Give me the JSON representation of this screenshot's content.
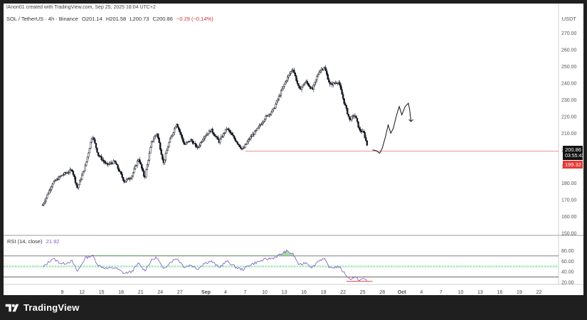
{
  "credit": "lAnon01 created with TradingView.com, Sep 25, 2025 18:04 UTC+2",
  "symbol": {
    "pair": "SOL / TetherUS · 4h · Binance",
    "open": "O201.14",
    "high": "H201.58",
    "low": "L200.73",
    "close": "C200.86",
    "change": "−0.29 (−0.14%)"
  },
  "currency": "USDT",
  "price_tag": "200.86",
  "countdown": "03:55:43",
  "level_tag": "199.32",
  "rsi_legend": {
    "label": "RSI (14, close)",
    "value": "21.92"
  },
  "brand": "TradingView",
  "colors": {
    "candle": "#131722",
    "level_line": "#e57373",
    "rsi_line": "#7e57c2",
    "overbought_fill": "#66bb6a",
    "mid_band": "#b9f6ca",
    "oversold_line": "#ef5350"
  },
  "chart_data": [
    {
      "type": "candlestick",
      "title": "",
      "ylim": [
        150,
        275
      ],
      "y_ticks": [
        150,
        160,
        170,
        180,
        190,
        200,
        210,
        220,
        230,
        240,
        250,
        260,
        270
      ],
      "y_tick_labels": [
        "150.00",
        "160.00",
        "170.00",
        "180.00",
        "190.00",
        "200.00",
        "210.00",
        "220.00",
        "230.00",
        "240.00",
        "250.00",
        "260.00",
        "270.00"
      ],
      "x_ticks": [
        {
          "day": 9,
          "label": "9"
        },
        {
          "day": 12,
          "label": "12"
        },
        {
          "day": 15,
          "label": "15"
        },
        {
          "day": 18,
          "label": "18"
        },
        {
          "day": 21,
          "label": "21"
        },
        {
          "day": 24,
          "label": "24"
        },
        {
          "day": 27,
          "label": "27"
        },
        {
          "day": 31,
          "label": "Sep"
        },
        {
          "day": 34,
          "label": "4"
        },
        {
          "day": 37,
          "label": "7"
        },
        {
          "day": 40,
          "label": "10"
        },
        {
          "day": 43,
          "label": "13"
        },
        {
          "day": 46,
          "label": "16"
        },
        {
          "day": 49,
          "label": "19"
        },
        {
          "day": 52,
          "label": "22"
        },
        {
          "day": 55,
          "label": "25"
        },
        {
          "day": 58,
          "label": "28"
        },
        {
          "day": 61,
          "label": "Oct"
        },
        {
          "day": 64,
          "label": "4"
        },
        {
          "day": 67,
          "label": "7"
        },
        {
          "day": 70,
          "label": "10"
        },
        {
          "day": 73,
          "label": "13"
        },
        {
          "day": 76,
          "label": "16"
        },
        {
          "day": 79,
          "label": "19"
        },
        {
          "day": 82,
          "label": "22"
        }
      ],
      "price_anchors": [
        {
          "day": 6.0,
          "price": 167
        },
        {
          "day": 7.5,
          "price": 180
        },
        {
          "day": 9.0,
          "price": 185
        },
        {
          "day": 10.5,
          "price": 188
        },
        {
          "day": 11.3,
          "price": 177
        },
        {
          "day": 12.5,
          "price": 190
        },
        {
          "day": 13.6,
          "price": 209
        },
        {
          "day": 14.5,
          "price": 197
        },
        {
          "day": 15.8,
          "price": 191
        },
        {
          "day": 17.0,
          "price": 193
        },
        {
          "day": 18.5,
          "price": 181
        },
        {
          "day": 19.6,
          "price": 184
        },
        {
          "day": 20.7,
          "price": 195
        },
        {
          "day": 21.6,
          "price": 183
        },
        {
          "day": 22.7,
          "price": 205
        },
        {
          "day": 23.5,
          "price": 210
        },
        {
          "day": 24.5,
          "price": 192
        },
        {
          "day": 25.3,
          "price": 204
        },
        {
          "day": 26.5,
          "price": 216
        },
        {
          "day": 27.7,
          "price": 203
        },
        {
          "day": 28.7,
          "price": 206
        },
        {
          "day": 29.7,
          "price": 201
        },
        {
          "day": 30.7,
          "price": 208
        },
        {
          "day": 31.8,
          "price": 212
        },
        {
          "day": 33.0,
          "price": 205
        },
        {
          "day": 34.2,
          "price": 213
        },
        {
          "day": 35.5,
          "price": 206
        },
        {
          "day": 36.6,
          "price": 200
        },
        {
          "day": 37.7,
          "price": 207
        },
        {
          "day": 38.8,
          "price": 212
        },
        {
          "day": 40.0,
          "price": 219
        },
        {
          "day": 41.3,
          "price": 224
        },
        {
          "day": 42.3,
          "price": 233
        },
        {
          "day": 43.3,
          "price": 242
        },
        {
          "day": 44.3,
          "price": 249
        },
        {
          "day": 45.3,
          "price": 236
        },
        {
          "day": 46.3,
          "price": 241
        },
        {
          "day": 47.3,
          "price": 236
        },
        {
          "day": 48.3,
          "price": 247
        },
        {
          "day": 49.1,
          "price": 250
        },
        {
          "day": 50.0,
          "price": 239
        },
        {
          "day": 51.3,
          "price": 241
        },
        {
          "day": 52.2,
          "price": 228
        },
        {
          "day": 53.0,
          "price": 218
        },
        {
          "day": 53.8,
          "price": 221
        },
        {
          "day": 54.5,
          "price": 212
        },
        {
          "day": 55.2,
          "price": 210
        },
        {
          "day": 55.8,
          "price": 201
        }
      ],
      "level_line": {
        "price": 199.32,
        "from_day": 37.0,
        "to_day": 85
      },
      "projection": [
        {
          "day": 56.5,
          "price": 200
        },
        {
          "day": 57.1,
          "price": 199.5
        },
        {
          "day": 57.6,
          "price": 198
        },
        {
          "day": 58.0,
          "price": 201
        },
        {
          "day": 58.5,
          "price": 208
        },
        {
          "day": 58.9,
          "price": 215
        },
        {
          "day": 59.3,
          "price": 210
        },
        {
          "day": 59.7,
          "price": 213
        },
        {
          "day": 60.2,
          "price": 221
        },
        {
          "day": 60.6,
          "price": 226
        },
        {
          "day": 61.0,
          "price": 221
        },
        {
          "day": 61.5,
          "price": 226
        },
        {
          "day": 62.0,
          "price": 228
        },
        {
          "day": 62.2,
          "price": 224
        },
        {
          "day": 62.4,
          "price": 217
        }
      ],
      "projection_arrow_at": {
        "day": 62.4,
        "price": 217
      }
    },
    {
      "type": "line",
      "title": "RSI (14, close)",
      "ylim": [
        20,
        90
      ],
      "y_ticks": [
        20,
        40,
        60,
        80
      ],
      "y_tick_labels": [
        "20.00",
        "40.00",
        "60.00",
        "80.00"
      ],
      "bands": {
        "upper": 70,
        "middle": 50,
        "lower": 30
      },
      "mid_zone": [
        47,
        53
      ],
      "anchors": [
        {
          "day": 6.0,
          "value": 48
        },
        {
          "day": 7.5,
          "value": 65
        },
        {
          "day": 9.0,
          "value": 55
        },
        {
          "day": 10.5,
          "value": 60
        },
        {
          "day": 11.3,
          "value": 40
        },
        {
          "day": 12.5,
          "value": 66
        },
        {
          "day": 13.6,
          "value": 71
        },
        {
          "day": 14.5,
          "value": 52
        },
        {
          "day": 15.8,
          "value": 46
        },
        {
          "day": 17.0,
          "value": 48
        },
        {
          "day": 18.5,
          "value": 37
        },
        {
          "day": 19.6,
          "value": 40
        },
        {
          "day": 20.7,
          "value": 56
        },
        {
          "day": 21.6,
          "value": 42
        },
        {
          "day": 22.7,
          "value": 62
        },
        {
          "day": 23.5,
          "value": 67
        },
        {
          "day": 24.5,
          "value": 44
        },
        {
          "day": 25.3,
          "value": 56
        },
        {
          "day": 26.5,
          "value": 66
        },
        {
          "day": 27.7,
          "value": 49
        },
        {
          "day": 28.7,
          "value": 53
        },
        {
          "day": 29.7,
          "value": 45
        },
        {
          "day": 30.7,
          "value": 56
        },
        {
          "day": 31.8,
          "value": 60
        },
        {
          "day": 33.0,
          "value": 48
        },
        {
          "day": 34.2,
          "value": 60
        },
        {
          "day": 35.5,
          "value": 49
        },
        {
          "day": 36.6,
          "value": 44
        },
        {
          "day": 37.7,
          "value": 53
        },
        {
          "day": 38.8,
          "value": 58
        },
        {
          "day": 40.0,
          "value": 63
        },
        {
          "day": 41.3,
          "value": 66
        },
        {
          "day": 42.3,
          "value": 72
        },
        {
          "day": 43.3,
          "value": 79
        },
        {
          "day": 44.3,
          "value": 74
        },
        {
          "day": 45.3,
          "value": 52
        },
        {
          "day": 46.3,
          "value": 58
        },
        {
          "day": 47.3,
          "value": 48
        },
        {
          "day": 48.3,
          "value": 62
        },
        {
          "day": 49.1,
          "value": 64
        },
        {
          "day": 50.0,
          "value": 47
        },
        {
          "day": 51.3,
          "value": 50
        },
        {
          "day": 52.2,
          "value": 38
        },
        {
          "day": 53.0,
          "value": 26
        },
        {
          "day": 53.8,
          "value": 30
        },
        {
          "day": 54.5,
          "value": 24
        },
        {
          "day": 55.2,
          "value": 27
        },
        {
          "day": 55.8,
          "value": 21.92
        }
      ],
      "oversold_marker": {
        "from_day": 52.5,
        "to_day": 56.5,
        "value": 22
      }
    }
  ]
}
